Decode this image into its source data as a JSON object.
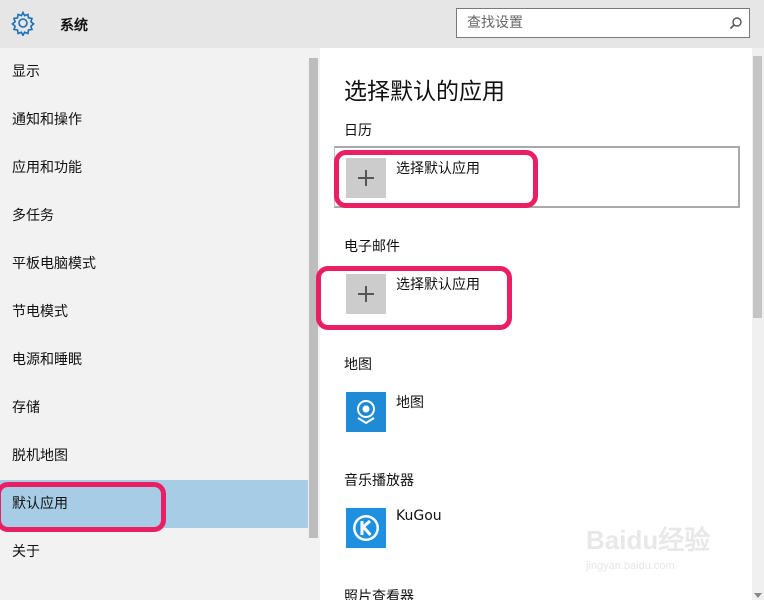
{
  "header": {
    "title": "系统",
    "search": {
      "placeholder": "查找设置",
      "value": ""
    }
  },
  "sidebar": {
    "items": [
      {
        "label": "显示"
      },
      {
        "label": "通知和操作"
      },
      {
        "label": "应用和功能"
      },
      {
        "label": "多任务"
      },
      {
        "label": "平板电脑模式"
      },
      {
        "label": "节电模式"
      },
      {
        "label": "电源和睡眠"
      },
      {
        "label": "存储"
      },
      {
        "label": "脱机地图"
      },
      {
        "label": "默认应用",
        "selected": true
      },
      {
        "label": "关于"
      }
    ]
  },
  "main": {
    "title": "选择默认的应用",
    "sections": [
      {
        "label": "日历",
        "app": "选择默认应用",
        "icon": "plus-icon"
      },
      {
        "label": "电子邮件",
        "app": "选择默认应用",
        "icon": "plus-icon"
      },
      {
        "label": "地图",
        "app": "地图",
        "icon": "maps-icon"
      },
      {
        "label": "音乐播放器",
        "app": "KuGou",
        "icon": "kugou-icon"
      },
      {
        "label": "照片查看器"
      }
    ]
  },
  "watermark": {
    "logo": "Baidu经验",
    "url": "jingyan.baidu.com"
  },
  "colors": {
    "header_bg": "#e6e6e6",
    "sidebar_bg": "#f2f2f2",
    "selected_bg": "#a7cce6",
    "highlight": "#ea1f63",
    "accent": "#1f8ad6"
  }
}
